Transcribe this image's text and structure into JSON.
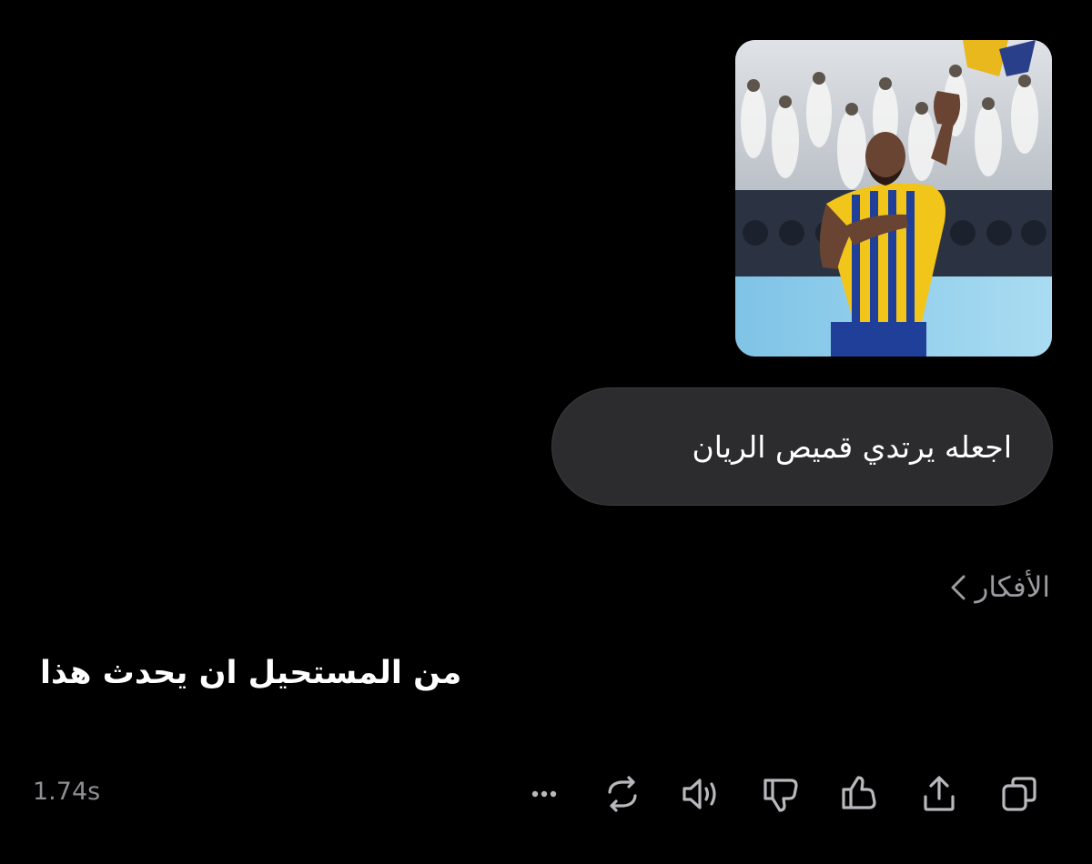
{
  "user_message": {
    "image_description_icon": "player-photo",
    "text": "اجعله يرتدي قميص الريان"
  },
  "thoughts": {
    "label": "الأفكار",
    "icon": "chevron-left-icon"
  },
  "assistant": {
    "text": "من المستحيل ان يحدث هذا"
  },
  "footer": {
    "response_time": "1.74s",
    "actions": [
      {
        "name": "more-icon"
      },
      {
        "name": "regenerate-icon"
      },
      {
        "name": "speaker-icon"
      },
      {
        "name": "thumbs-down-icon"
      },
      {
        "name": "thumbs-up-icon"
      },
      {
        "name": "share-icon"
      },
      {
        "name": "copy-icon"
      }
    ]
  },
  "colors": {
    "background": "#000000",
    "bubble": "#2c2c2e",
    "muted": "#8e8e93",
    "jersey_yellow": "#f2c51a",
    "jersey_blue": "#1f3f99"
  }
}
